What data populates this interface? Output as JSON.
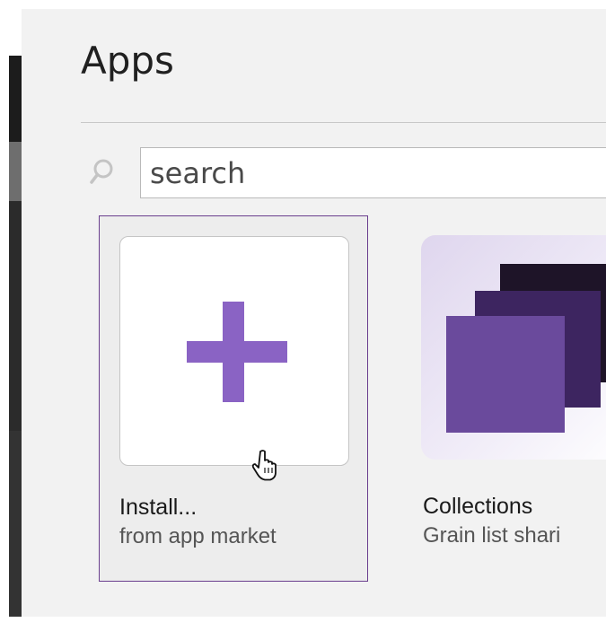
{
  "header": {
    "title": "Apps"
  },
  "search": {
    "placeholder": "search",
    "icon": "search-icon"
  },
  "apps": [
    {
      "name": "Install...",
      "subtitle": "from app market",
      "icon": "plus-icon",
      "selected": true
    },
    {
      "name": "Collections",
      "subtitle": "Grain list shari",
      "icon": "collections-icon",
      "selected": false
    }
  ],
  "colors": {
    "accent": "#8a63c4",
    "selection_border": "#6a3e8e",
    "collections_dark": "#1e1428",
    "collections_mid": "#3d2560",
    "collections_front": "#6a4a9c"
  }
}
